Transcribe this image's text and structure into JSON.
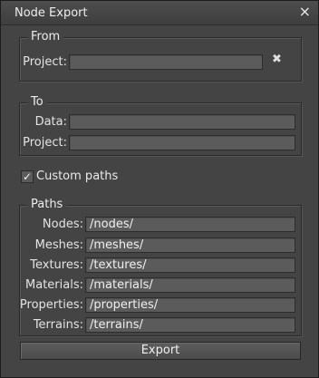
{
  "window": {
    "title": "Node Export",
    "close_glyph": "×"
  },
  "from": {
    "legend": "From",
    "project_label": "Project:",
    "project_value": "",
    "clear_glyph": "✖"
  },
  "to": {
    "legend": "To",
    "data_label": "Data:",
    "data_value": "",
    "project_label": "Project:",
    "project_value": ""
  },
  "custom_paths": {
    "label": "Custom paths",
    "checked": true,
    "check_glyph": "✓"
  },
  "paths": {
    "legend": "Paths",
    "rows": [
      {
        "label": "Nodes:",
        "value": "/nodes/"
      },
      {
        "label": "Meshes:",
        "value": "/meshes/"
      },
      {
        "label": "Textures:",
        "value": "/textures/"
      },
      {
        "label": "Materials:",
        "value": "/materials/"
      },
      {
        "label": "Properties:",
        "value": "/properties/"
      },
      {
        "label": "Terrains:",
        "value": "/terrains/"
      }
    ]
  },
  "export_button": "Export"
}
